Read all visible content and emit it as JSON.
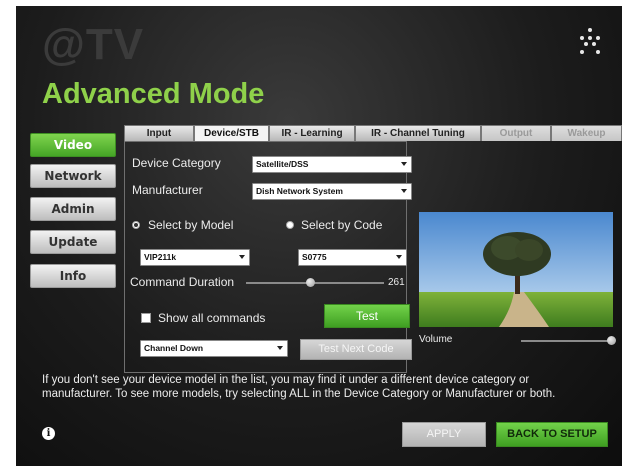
{
  "header": {
    "logo_text": "@TV",
    "title": "Advanced Mode"
  },
  "sidebar": {
    "items": [
      {
        "label": "Video",
        "active": true
      },
      {
        "label": "Network",
        "active": false
      },
      {
        "label": "Admin",
        "active": false
      },
      {
        "label": "Update",
        "active": false
      },
      {
        "label": "Info",
        "active": false
      }
    ]
  },
  "tabs": [
    {
      "label": "Input",
      "state": "normal"
    },
    {
      "label": "Device/STB",
      "state": "active"
    },
    {
      "label": "IR - Learning",
      "state": "normal"
    },
    {
      "label": "IR - Channel Tuning",
      "state": "normal"
    },
    {
      "label": "Output",
      "state": "disabled"
    },
    {
      "label": "Wakeup",
      "state": "disabled"
    }
  ],
  "device": {
    "category_label": "Device Category",
    "category_value": "Satellite/DSS",
    "manufacturer_label": "Manufacturer",
    "manufacturer_value": "Dish Network System",
    "select_by_model_label": "Select by Model",
    "select_by_code_label": "Select by Code",
    "selected_mode": "model",
    "model_value": "VIP211k",
    "code_value": "S0775",
    "command_duration_label": "Command Duration",
    "command_duration_value": "261",
    "command_duration_fraction": 0.47,
    "show_all_label": "Show all commands",
    "show_all_checked": false,
    "test_label": "Test",
    "command_value": "Channel Down",
    "test_next_label": "Test Next Code"
  },
  "volume": {
    "label": "Volume",
    "level": 1.0
  },
  "footer": {
    "info_text": "If you don't see your device model in the list, you may find it under a different device category or manufacturer. To see more models, try selecting ALL in the Device Category or Manufacturer or both.",
    "info_icon_glyph": "i",
    "apply_label": "APPLY",
    "back_label": "BACK TO SETUP"
  },
  "colors": {
    "accent_green": "#6cc644",
    "title_green": "#8fd14a",
    "background": "#1c1c1c"
  }
}
